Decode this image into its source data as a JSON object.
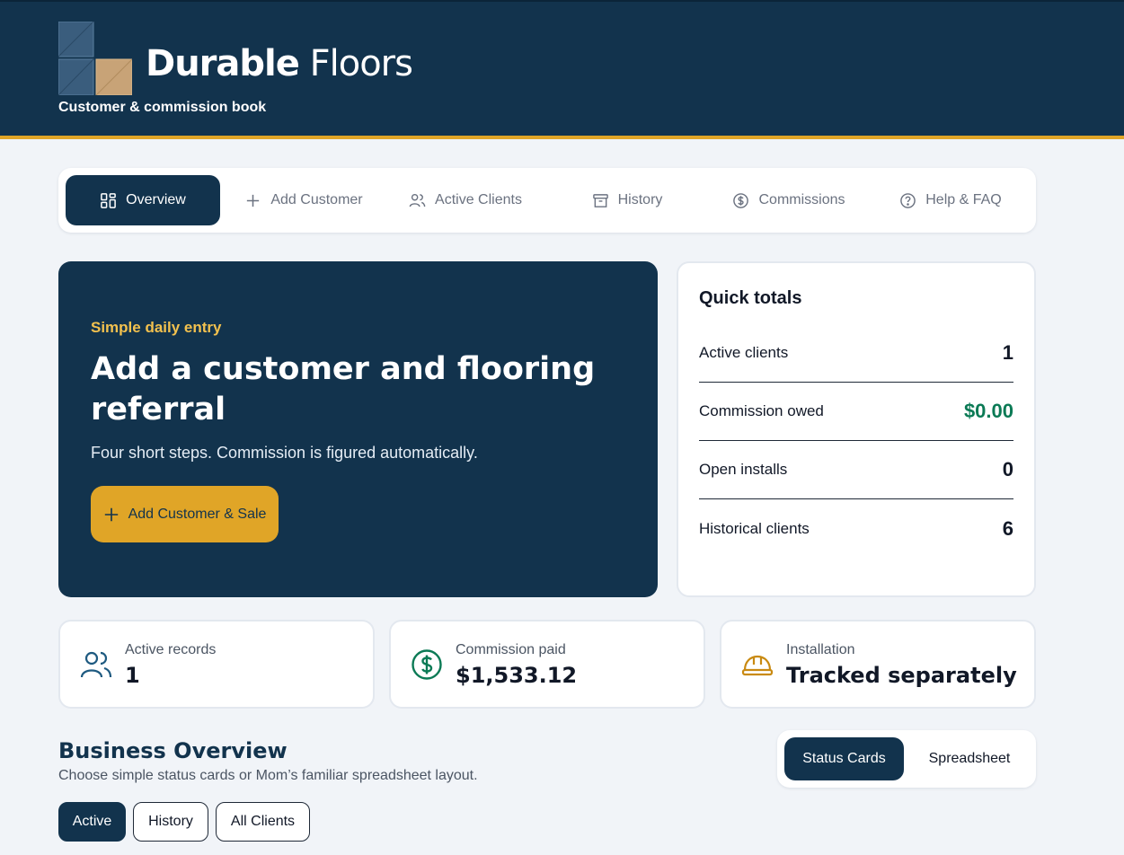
{
  "header": {
    "brand_bold": "Durable",
    "brand_light": "Floors",
    "tagline": "Customer & commission book"
  },
  "nav": {
    "tabs": [
      {
        "label": "Overview",
        "icon": "grid-icon",
        "active": true
      },
      {
        "label": "Add Customer",
        "icon": "plus-icon",
        "active": false
      },
      {
        "label": "Active Clients",
        "icon": "users-icon",
        "active": false
      },
      {
        "label": "History",
        "icon": "archive-icon",
        "active": false
      },
      {
        "label": "Commissions",
        "icon": "dollar-circle-icon",
        "active": false
      },
      {
        "label": "Help & FAQ",
        "icon": "help-circle-icon",
        "active": false
      }
    ]
  },
  "hero": {
    "kicker": "Simple daily entry",
    "title": "Add a customer and flooring referral",
    "subtitle": "Four short steps. Commission is figured automatically.",
    "button_label": "Add Customer & Sale"
  },
  "quick_totals": {
    "title": "Quick totals",
    "rows": [
      {
        "label": "Active clients",
        "value": "1"
      },
      {
        "label": "Commission owed",
        "value": "$0.00"
      },
      {
        "label": "Open installs",
        "value": "0"
      },
      {
        "label": "Historical clients",
        "value": "6"
      }
    ]
  },
  "stats": [
    {
      "label": "Active records",
      "value": "1",
      "icon": "users-icon"
    },
    {
      "label": "Commission paid",
      "value": "$1,533.12",
      "icon": "dollar-circle-icon"
    },
    {
      "label": "Installation",
      "value": "Tracked separately",
      "icon": "hard-hat-icon"
    }
  ],
  "business_overview": {
    "title": "Business Overview",
    "subtitle": "Choose simple status cards or Mom’s familiar spreadsheet layout.",
    "view_options": [
      "Status Cards",
      "Spreadsheet"
    ],
    "selected_view": "Status Cards",
    "filters": [
      "Active",
      "History",
      "All Clients"
    ],
    "selected_filter": "Active"
  },
  "colors": {
    "navy": "#12334d",
    "gold": "#e0a527",
    "kicker_gold": "#f2c14e",
    "green": "#0b7a55",
    "background": "#f1f4f8"
  }
}
